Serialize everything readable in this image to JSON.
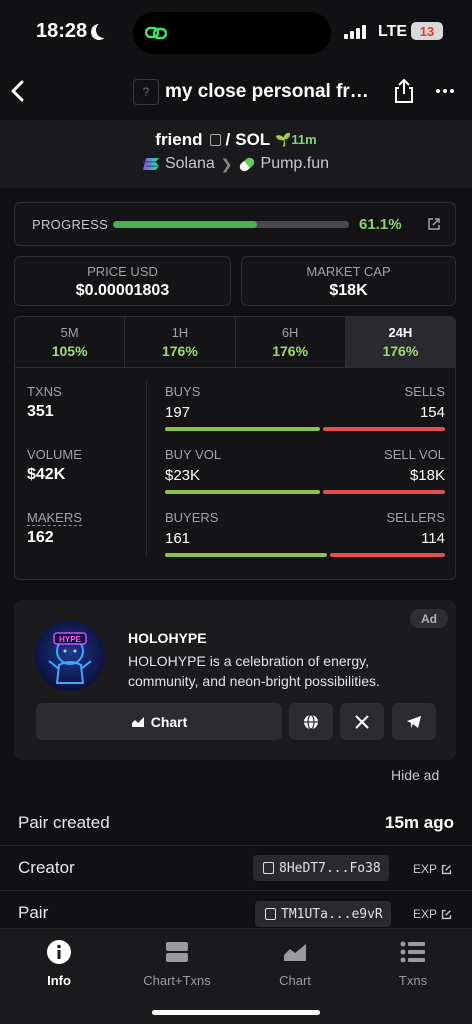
{
  "status_bar": {
    "time": "18:28",
    "network": "LTE",
    "battery": "13"
  },
  "header": {
    "token_placeholder": "?",
    "title": "my close personal friend"
  },
  "pair": {
    "base": "friend",
    "separator": "/",
    "quote": "SOL",
    "age": "11m",
    "chain": "Solana",
    "dex": "Pump.fun"
  },
  "progress": {
    "label": "PROGRESS",
    "value_text": "61.1%",
    "fraction": 0.611
  },
  "price": {
    "label": "PRICE USD",
    "value": "$0.00001803"
  },
  "market_cap": {
    "label": "MARKET CAP",
    "value": "$18K"
  },
  "timeframes": [
    {
      "name": "5M",
      "change": "105%"
    },
    {
      "name": "1H",
      "change": "176%"
    },
    {
      "name": "6H",
      "change": "176%"
    },
    {
      "name": "24H",
      "change": "176%"
    }
  ],
  "stats": {
    "txns": {
      "label": "TXNS",
      "value": "351"
    },
    "volume": {
      "label": "VOLUME",
      "value": "$42K"
    },
    "makers": {
      "label": "MAKERS",
      "value": "162"
    },
    "buys_sells": {
      "left_label": "BUYS",
      "right_label": "SELLS",
      "left_value": "197",
      "right_value": "154",
      "left_fraction": 0.561
    },
    "vol_split": {
      "left_label": "BUY VOL",
      "right_label": "SELL VOL",
      "left_value": "$23K",
      "right_value": "$18K",
      "left_fraction": 0.561
    },
    "buyers_sellers": {
      "left_label": "BUYERS",
      "right_label": "SELLERS",
      "left_value": "161",
      "right_value": "114",
      "left_fraction": 0.585
    }
  },
  "ad": {
    "badge": "Ad",
    "logo_text": "HYPE",
    "title": "HOLOHYPE",
    "description": "HOLOHYPE is a celebration of energy, community, and neon-bright possibilities.",
    "chart_button": "Chart",
    "hide": "Hide ad"
  },
  "info": {
    "pair_created": {
      "label": "Pair created",
      "value": "15m ago"
    },
    "creator": {
      "label": "Creator",
      "address": "8HeDT7...Fo38",
      "exp": "EXP"
    },
    "pair": {
      "label": "Pair",
      "address": "TM1UTa...e9vR",
      "exp": "EXP"
    }
  },
  "tabs": [
    {
      "label": "Info",
      "icon": "info-icon"
    },
    {
      "label": "Chart+Txns",
      "icon": "split-icon"
    },
    {
      "label": "Chart",
      "icon": "chart-icon"
    },
    {
      "label": "Txns",
      "icon": "list-icon"
    }
  ],
  "colors": {
    "green": "#8bc34a",
    "red": "#e05050",
    "progress": "#4caf50",
    "accent_text": "#a3d977"
  }
}
